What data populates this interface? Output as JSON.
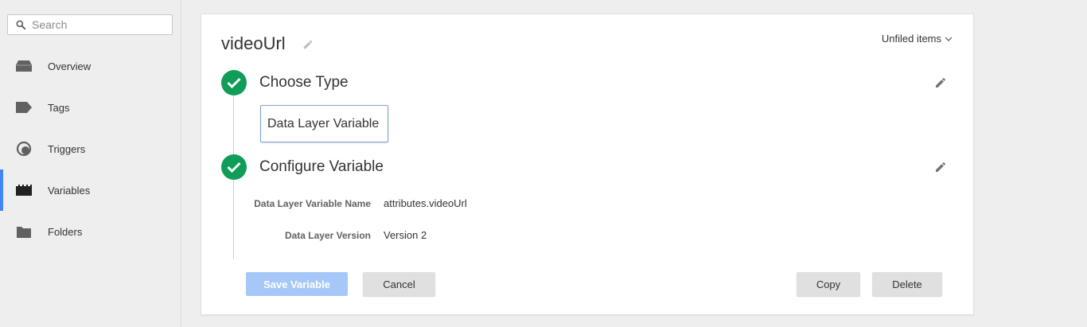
{
  "search": {
    "placeholder": "Search"
  },
  "sidebar": {
    "items": [
      {
        "label": "Overview",
        "icon": "overview-icon"
      },
      {
        "label": "Tags",
        "icon": "tag-icon"
      },
      {
        "label": "Triggers",
        "icon": "trigger-icon"
      },
      {
        "label": "Variables",
        "icon": "variables-icon",
        "active": true
      },
      {
        "label": "Folders",
        "icon": "folder-icon"
      }
    ]
  },
  "editor": {
    "title": "videoUrl",
    "folder": "Unfiled items",
    "steps": [
      {
        "title": "Choose Type",
        "value": "Data Layer Variable"
      },
      {
        "title": "Configure Variable"
      }
    ],
    "fields": [
      {
        "label": "Data Layer Variable Name",
        "value": "attributes.videoUrl"
      },
      {
        "label": "Data Layer Version",
        "value": "Version 2"
      }
    ],
    "buttons": {
      "save": "Save Variable",
      "cancel": "Cancel",
      "copy": "Copy",
      "delete": "Delete"
    }
  },
  "colors": {
    "accent": "#4285f4",
    "success": "#0f9d58",
    "save_disabled": "#a6c8f8"
  }
}
